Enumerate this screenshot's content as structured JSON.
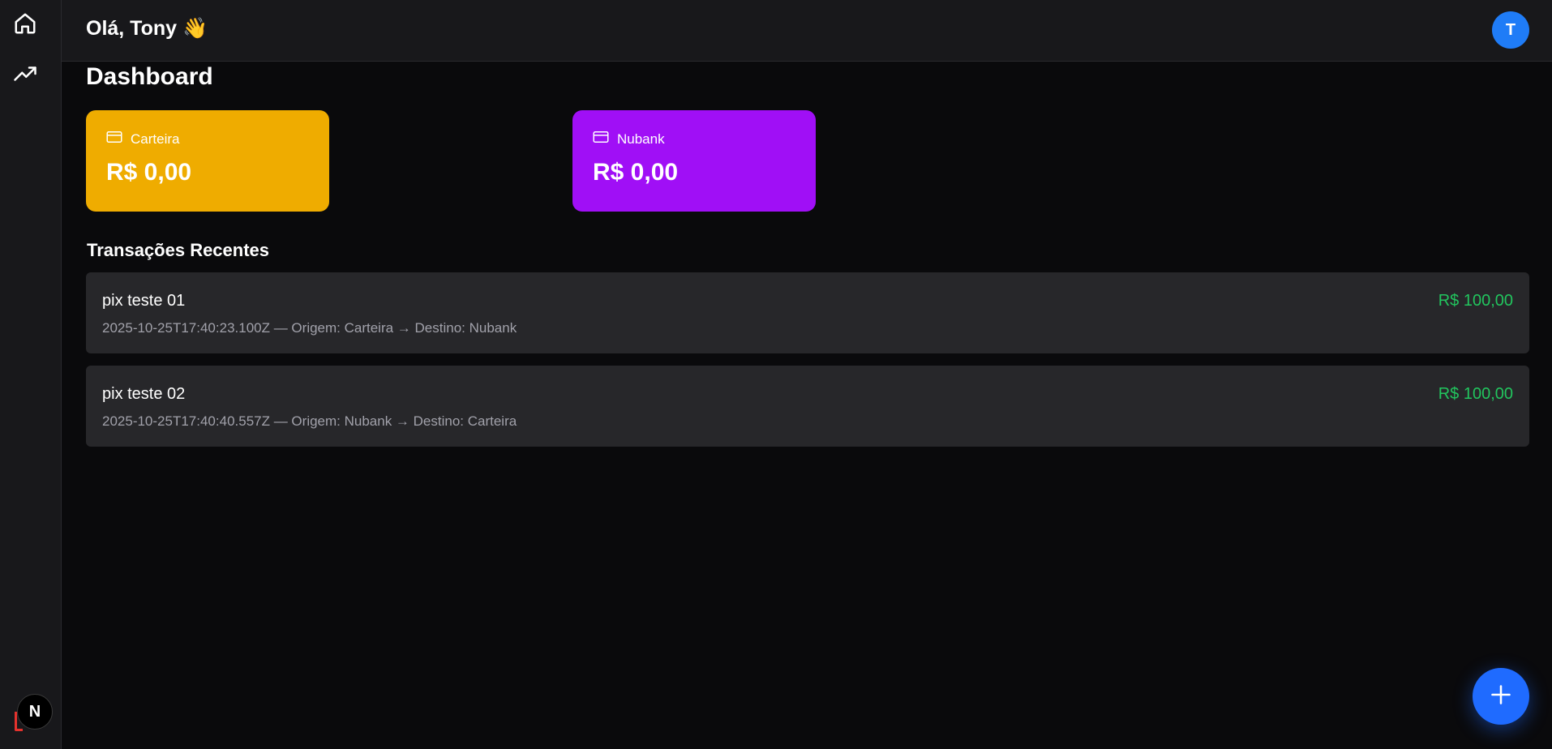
{
  "sidebar": {
    "items": [
      {
        "icon": "home-icon",
        "label": "Home"
      },
      {
        "icon": "trending-up-icon",
        "label": "Trending"
      }
    ],
    "badge_letter": "N"
  },
  "header": {
    "greeting": "Olá, Tony 👋",
    "avatar_initial": "T"
  },
  "main": {
    "title": "Dashboard",
    "accounts": [
      {
        "name": "Carteira",
        "balance": "R$ 0,00",
        "color": "#efac00",
        "icon": "credit-card-icon"
      },
      {
        "name": "Nubank",
        "balance": "R$ 0,00",
        "color": "#a00ff6",
        "icon": "credit-card-icon"
      }
    ],
    "recent_title": "Transações Recentes",
    "transactions": [
      {
        "name": "pix teste 01",
        "details": "2025-10-25T17:40:23.100Z — Origem: Carteira → Destino: Nubank",
        "amount": "R$ 100,00"
      },
      {
        "name": "pix teste 02",
        "details": "2025-10-25T17:40:40.557Z — Origem: Nubank → Destino: Carteira",
        "amount": "R$ 100,00"
      }
    ]
  },
  "fab": {
    "icon": "plus-icon"
  },
  "colors": {
    "background": "#0a0a0c",
    "surface": "#18181b",
    "row": "#27272a",
    "accent": "#1f6bff",
    "positive": "#22c55e"
  }
}
